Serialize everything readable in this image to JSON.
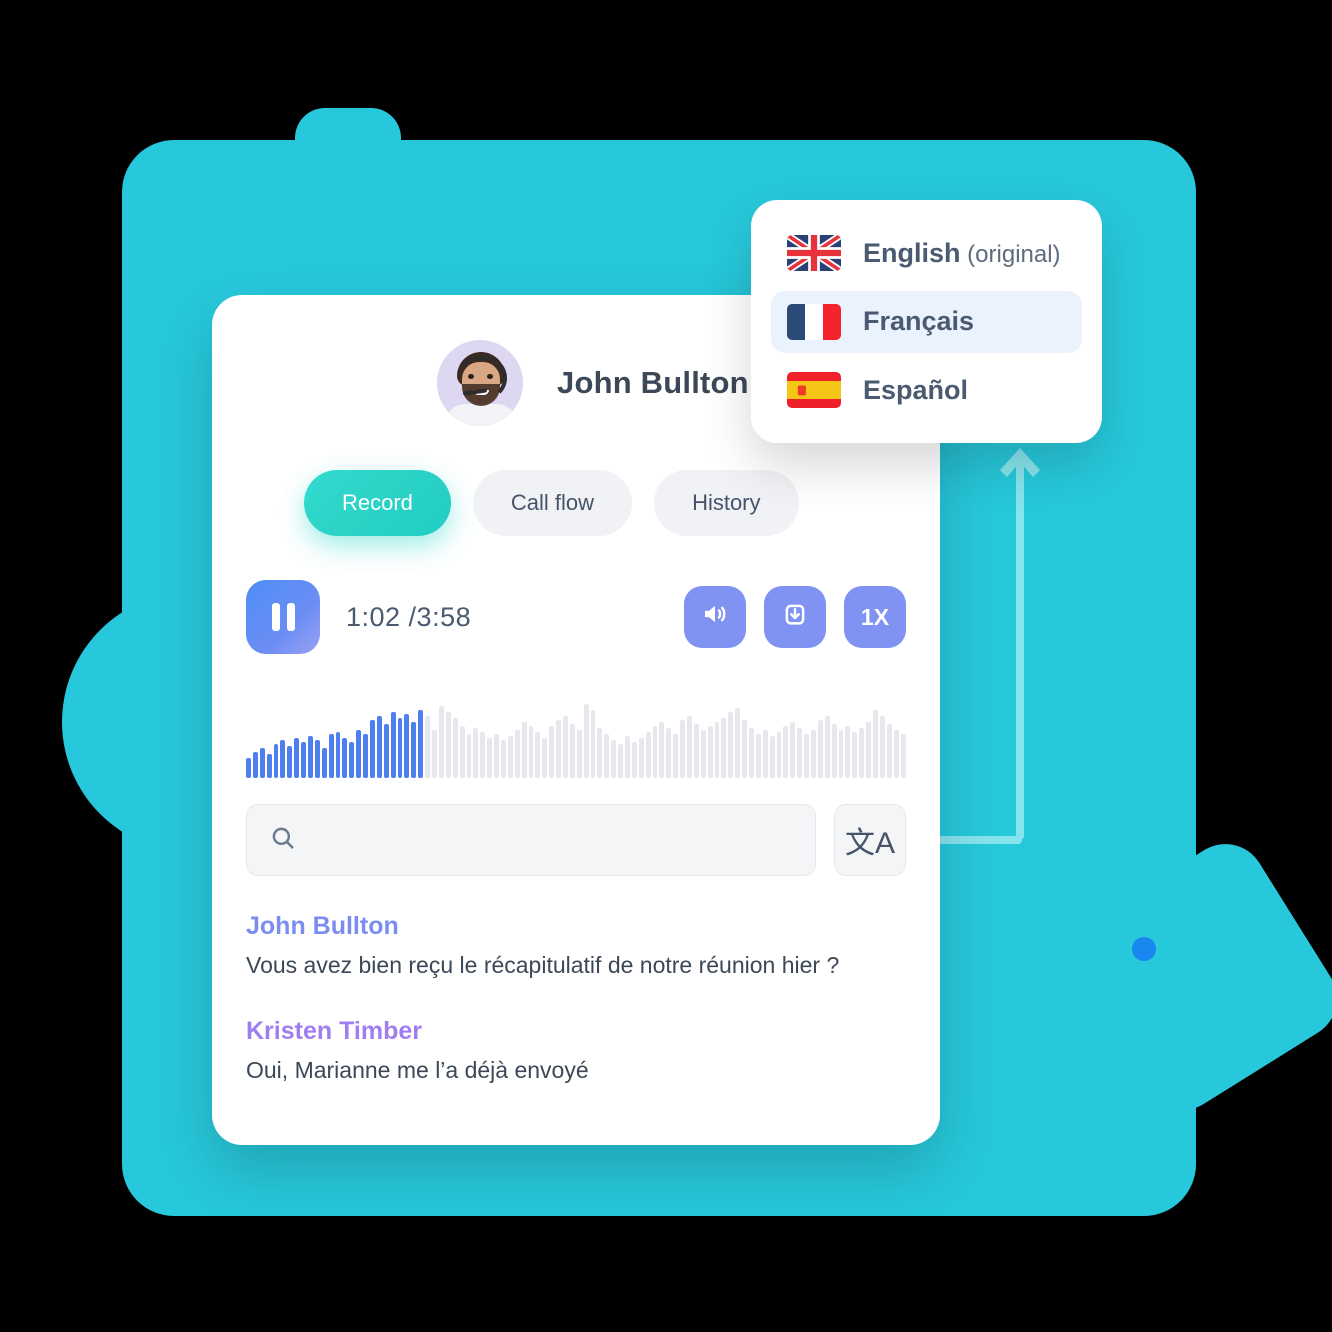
{
  "theme": {
    "teal": "#27c8db",
    "accent_green": "#2ad3c6",
    "accent_blue": "#8193f2",
    "connector": "#86e4ec",
    "dot": "#1a86f0",
    "john_color": "#7b8df0",
    "kristen_color": "#a07ef0"
  },
  "card": {
    "caller_name": "John Bullton",
    "avatar_alt": "agent-avatar",
    "tabs": [
      {
        "label": "Record",
        "active": true
      },
      {
        "label": "Call flow",
        "active": false
      },
      {
        "label": "History",
        "active": false
      }
    ],
    "player": {
      "state_icon": "pause-icon",
      "current_time": "1:02",
      "separator": " /",
      "total_time": "3:58",
      "time_display": "1:02 /3:58",
      "actions": [
        {
          "name": "volume-button",
          "icon": "speaker-icon",
          "label": ""
        },
        {
          "name": "download-button",
          "icon": "download-icon",
          "label": ""
        },
        {
          "name": "speed-button",
          "icon": "speed-text",
          "label": "1X"
        }
      ]
    },
    "waveform": {
      "progress_bars": 26,
      "total_bars": 96,
      "heights": [
        20,
        26,
        30,
        24,
        34,
        38,
        32,
        40,
        36,
        42,
        38,
        30,
        44,
        46,
        40,
        36,
        48,
        44,
        58,
        62,
        54,
        66,
        60,
        64,
        56,
        68,
        62,
        48,
        72,
        66,
        60,
        52,
        44,
        50,
        46,
        40,
        44,
        38,
        42,
        48,
        56,
        52,
        46,
        40,
        52,
        58,
        62,
        54,
        48,
        74,
        68,
        50,
        44,
        38,
        34,
        42,
        36,
        40,
        46,
        52,
        56,
        50,
        44,
        58,
        62,
        54,
        48,
        52,
        56,
        60,
        66,
        70,
        58,
        50,
        44,
        48,
        42,
        46,
        52,
        56,
        50,
        44,
        48,
        58,
        62,
        54,
        48,
        52,
        46,
        50,
        56,
        68,
        62,
        54,
        48,
        44
      ]
    },
    "search": {
      "icon": "search-icon",
      "value": "",
      "placeholder": ""
    },
    "translate_button": {
      "icon": "translate-icon",
      "glyph": "文A"
    },
    "transcript": [
      {
        "speaker": "John Bullton",
        "color_key": "john",
        "text": "Vous avez bien reçu le récapitulatif de notre réunion hier ?"
      },
      {
        "speaker": "Kristen Timber",
        "color_key": "kristen",
        "text": "Oui, Marianne me l’a déjà envoyé"
      }
    ]
  },
  "language_dropdown": {
    "items": [
      {
        "flag": "uk-flag",
        "label": "English",
        "suffix": " (original)",
        "selected": false
      },
      {
        "flag": "france-flag",
        "label": "Français",
        "suffix": "",
        "selected": true
      },
      {
        "flag": "spain-flag",
        "label": "Español",
        "suffix": "",
        "selected": false
      }
    ]
  }
}
